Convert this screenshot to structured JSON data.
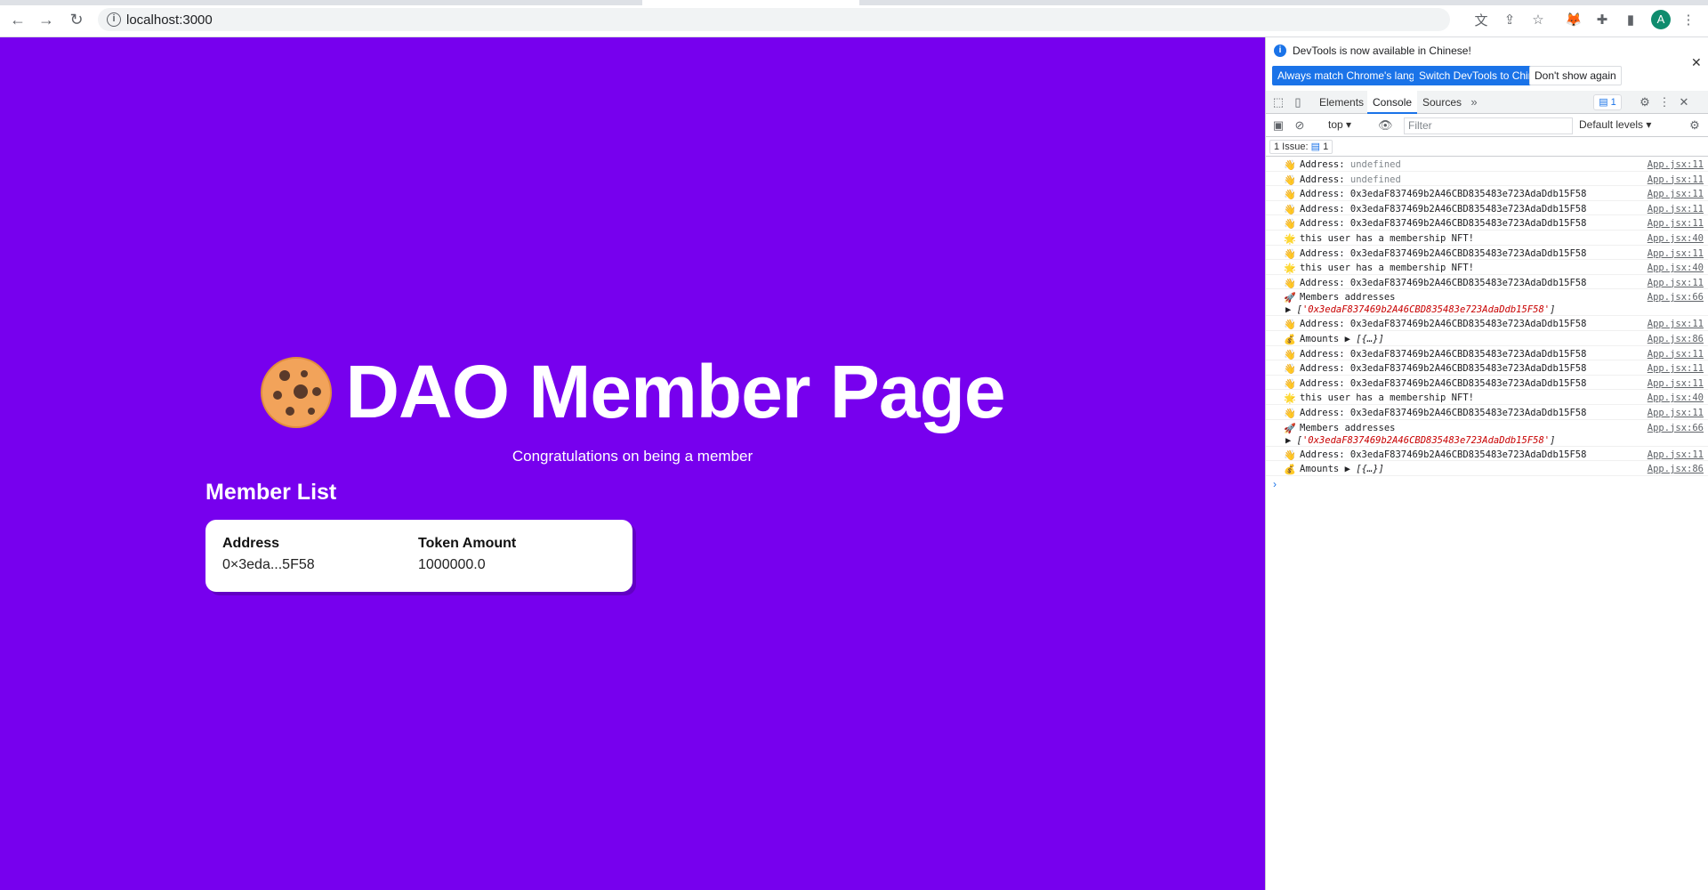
{
  "browser": {
    "url": "localhost:3000",
    "avatar_letter": "A"
  },
  "page": {
    "title": "DAO Member Page",
    "subtitle": "Congratulations on being a member",
    "member_list_title": "Member List",
    "table": {
      "columns": [
        "Address",
        "Token Amount"
      ],
      "rows": [
        [
          "0×3eda...5F58",
          "1000000.0"
        ]
      ]
    },
    "colors": {
      "background": "#7700ee"
    }
  },
  "devtools": {
    "banner": {
      "message": "DevTools is now available in Chinese!",
      "buttons": [
        "Always match Chrome's language",
        "Switch DevTools to Chinese",
        "Don't show again"
      ]
    },
    "tabs": [
      "Elements",
      "Console",
      "Sources"
    ],
    "active_tab": "Console",
    "issues_badge": "1",
    "context": "top",
    "filter_placeholder": "Filter",
    "levels": "Default levels",
    "issues_bar": "1 Issue:",
    "issues_count": "1",
    "logs": [
      {
        "emoji": "👋",
        "text": "Address:",
        "value": "undefined",
        "undefined": true,
        "src": "App.jsx:11"
      },
      {
        "emoji": "👋",
        "text": "Address:",
        "value": "undefined",
        "undefined": true,
        "src": "App.jsx:11"
      },
      {
        "emoji": "👋",
        "text": "Address:",
        "value": "0x3edaF837469b2A46CBD835483e723AdaDdb15F58",
        "src": "App.jsx:11"
      },
      {
        "emoji": "👋",
        "text": "Address:",
        "value": "0x3edaF837469b2A46CBD835483e723AdaDdb15F58",
        "src": "App.jsx:11"
      },
      {
        "emoji": "👋",
        "text": "Address:",
        "value": "0x3edaF837469b2A46CBD835483e723AdaDdb15F58",
        "src": "App.jsx:11"
      },
      {
        "emoji": "🌟",
        "text": "this user has a membership NFT!",
        "value": "",
        "src": "App.jsx:40"
      },
      {
        "emoji": "👋",
        "text": "Address:",
        "value": "0x3edaF837469b2A46CBD835483e723AdaDdb15F58",
        "src": "App.jsx:11"
      },
      {
        "emoji": "🌟",
        "text": "this user has a membership NFT!",
        "value": "",
        "src": "App.jsx:40"
      },
      {
        "emoji": "👋",
        "text": "Address:",
        "value": "0x3edaF837469b2A46CBD835483e723AdaDdb15F58",
        "src": "App.jsx:11"
      },
      {
        "emoji": "🚀",
        "text": "Members addresses",
        "value": "",
        "src": "App.jsx:66",
        "array": "'0x3edaF837469b2A46CBD835483e723AdaDdb15F58'"
      },
      {
        "emoji": "👋",
        "text": "Address:",
        "value": "0x3edaF837469b2A46CBD835483e723AdaDdb15F58",
        "src": "App.jsx:11"
      },
      {
        "emoji": "💰",
        "text": "Amounts",
        "value": "",
        "src": "App.jsx:86",
        "object": "[{…}]"
      },
      {
        "emoji": "👋",
        "text": "Address:",
        "value": "0x3edaF837469b2A46CBD835483e723AdaDdb15F58",
        "src": "App.jsx:11"
      },
      {
        "emoji": "👋",
        "text": "Address:",
        "value": "0x3edaF837469b2A46CBD835483e723AdaDdb15F58",
        "src": "App.jsx:11"
      },
      {
        "emoji": "👋",
        "text": "Address:",
        "value": "0x3edaF837469b2A46CBD835483e723AdaDdb15F58",
        "src": "App.jsx:11"
      },
      {
        "emoji": "🌟",
        "text": "this user has a membership NFT!",
        "value": "",
        "src": "App.jsx:40"
      },
      {
        "emoji": "👋",
        "text": "Address:",
        "value": "0x3edaF837469b2A46CBD835483e723AdaDdb15F58",
        "src": "App.jsx:11"
      },
      {
        "emoji": "🚀",
        "text": "Members addresses",
        "value": "",
        "src": "App.jsx:66",
        "array": "'0x3edaF837469b2A46CBD835483e723AdaDdb15F58'"
      },
      {
        "emoji": "👋",
        "text": "Address:",
        "value": "0x3edaF837469b2A46CBD835483e723AdaDdb15F58",
        "src": "App.jsx:11"
      },
      {
        "emoji": "💰",
        "text": "Amounts",
        "value": "",
        "src": "App.jsx:86",
        "object": "[{…}]"
      }
    ]
  }
}
